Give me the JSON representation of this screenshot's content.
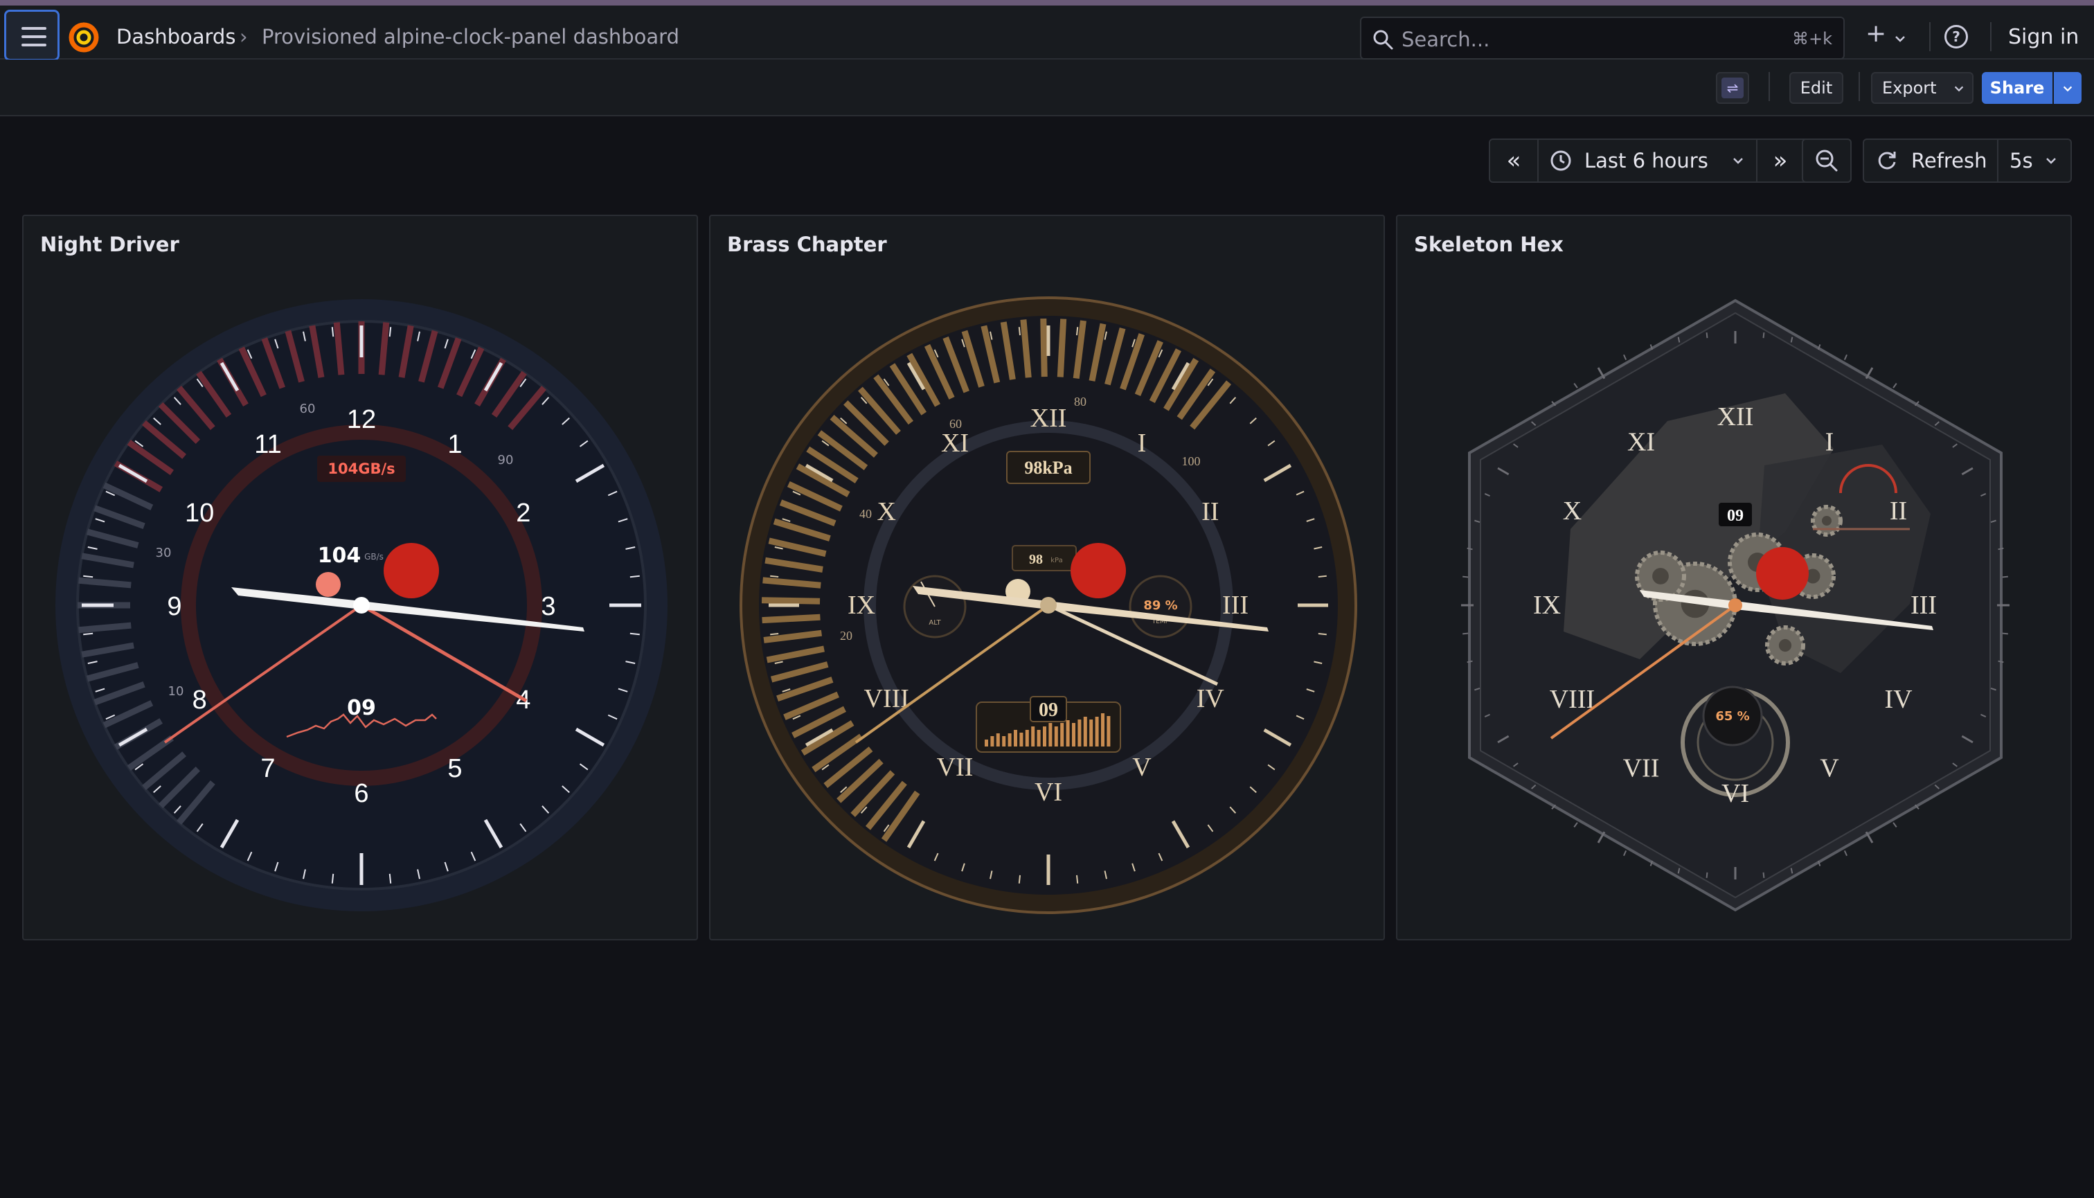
{
  "breadcrumb": {
    "home": "Dashboards",
    "separator": "›",
    "current": "Provisioned alpine-clock-panel dashboard"
  },
  "search": {
    "placeholder": "Search...",
    "shortcut": "⌘+k"
  },
  "header": {
    "plus_icon": "+",
    "help_icon": "?",
    "sign_in": "Sign in"
  },
  "toolbar": {
    "swap_icon": "⇌",
    "edit": "Edit",
    "export": "Export",
    "share": "Share"
  },
  "time_picker": {
    "prev": "«",
    "range": "Last 6 hours",
    "next": "»",
    "refresh": "Refresh",
    "interval": "5s"
  },
  "panels": [
    {
      "title": "Night Driver",
      "hour_labels": [
        "12",
        "1",
        "2",
        "3",
        "4",
        "5",
        "6",
        "7",
        "8",
        "9",
        "10",
        "11"
      ],
      "scale_labels": [
        "60",
        "90",
        "30",
        "10"
      ],
      "rate_label": "104GB/s",
      "value": "104",
      "value_unit": "GB/s",
      "date": "09",
      "accent": "#e0685a"
    },
    {
      "title": "Brass Chapter",
      "hour_labels": [
        "XII",
        "I",
        "II",
        "III",
        "IV",
        "V",
        "VI",
        "VII",
        "VIII",
        "IX",
        "X",
        "XI"
      ],
      "scale_labels": [
        "80",
        "100",
        "60",
        "40",
        "20"
      ],
      "pressure": "98kPa",
      "value": "98",
      "value_unit": "kPa",
      "sub_left": "ALT",
      "sub_right_value": "89 %",
      "sub_right_label": "TEMP",
      "date": "09",
      "accent": "#c79a5d"
    },
    {
      "title": "Skeleton Hex",
      "hour_labels": [
        "XII",
        "I",
        "II",
        "III",
        "IV",
        "V",
        "VI",
        "VII",
        "VIII",
        "IX",
        "X",
        "XI"
      ],
      "date": "09",
      "sub_value": "65 %",
      "accent": "#e08a50"
    }
  ],
  "colors": {
    "accent_blue": "#3d71d9",
    "red_dot": "#c9241b",
    "bg": "#111217",
    "panel": "#181b1f"
  }
}
